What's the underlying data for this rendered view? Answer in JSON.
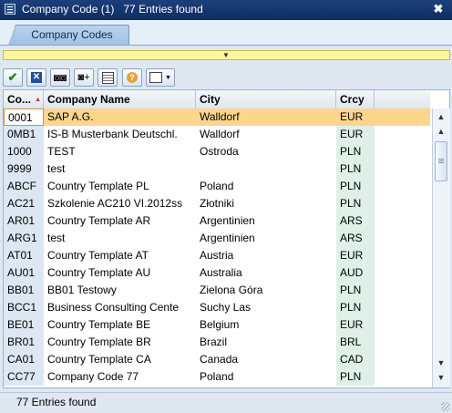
{
  "window": {
    "title": "Company Code (1)   77 Entries found",
    "close_symbol": "✖"
  },
  "tabs": [
    {
      "label": "Company Codes",
      "active": true
    }
  ],
  "toolbar": {
    "buttons": [
      {
        "name": "confirm-button",
        "icon": "checkmark-icon"
      },
      {
        "name": "cancel-button",
        "icon": "close-box-icon"
      },
      {
        "name": "find-button",
        "icon": "binoculars-icon"
      },
      {
        "name": "find-next-button",
        "icon": "binoculars-plus-icon"
      },
      {
        "name": "save-selection-button",
        "icon": "grid-icon"
      },
      {
        "name": "help-button",
        "icon": "help-icon"
      },
      {
        "name": "print-button",
        "icon": "printer-icon"
      }
    ]
  },
  "table": {
    "columns": [
      "Co...",
      "Company Name",
      "City",
      "Crcy",
      ""
    ],
    "rows": [
      {
        "code": "0001",
        "name": "SAP A.G.",
        "city": "Walldorf",
        "currency": "EUR",
        "selected": true
      },
      {
        "code": "0MB1",
        "name": "IS-B Musterbank Deutschl.",
        "city": "Walldorf",
        "currency": "EUR"
      },
      {
        "code": "1000",
        "name": "TEST",
        "city": "Ostroda",
        "currency": "PLN"
      },
      {
        "code": "9999",
        "name": "test",
        "city": "",
        "currency": "PLN"
      },
      {
        "code": "ABCF",
        "name": "Country Template PL",
        "city": "Poland",
        "currency": "PLN"
      },
      {
        "code": "AC21",
        "name": "Szkolenie AC210 VI.2012ss",
        "city": "Złotniki",
        "currency": "PLN"
      },
      {
        "code": "AR01",
        "name": "Country Template AR",
        "city": "Argentinien",
        "currency": "ARS"
      },
      {
        "code": "ARG1",
        "name": "test",
        "city": "Argentinien",
        "currency": "ARS"
      },
      {
        "code": "AT01",
        "name": "Country Template AT",
        "city": "Austria",
        "currency": "EUR"
      },
      {
        "code": "AU01",
        "name": "Country Template AU",
        "city": "Australia",
        "currency": "AUD"
      },
      {
        "code": "BB01",
        "name": "BB01 Testowy",
        "city": "Zielona Góra",
        "currency": "PLN"
      },
      {
        "code": "BCC1",
        "name": "Business Consulting Cente",
        "city": "Suchy Las",
        "currency": "PLN"
      },
      {
        "code": "BE01",
        "name": "Country Template BE",
        "city": "Belgium",
        "currency": "EUR"
      },
      {
        "code": "BR01",
        "name": "Country Template BR",
        "city": "Brazil",
        "currency": "BRL"
      },
      {
        "code": "CA01",
        "name": "Country Template CA",
        "city": "Canada",
        "currency": "CAD"
      },
      {
        "code": "CC77",
        "name": "Company Code 77",
        "city": "Poland",
        "currency": "PLN"
      }
    ]
  },
  "status": {
    "text": "77 Entries found"
  },
  "colors": {
    "title_bar": "#0e2d63",
    "selected_row": "#fdd68c",
    "filter_bar": "#fff59b"
  }
}
